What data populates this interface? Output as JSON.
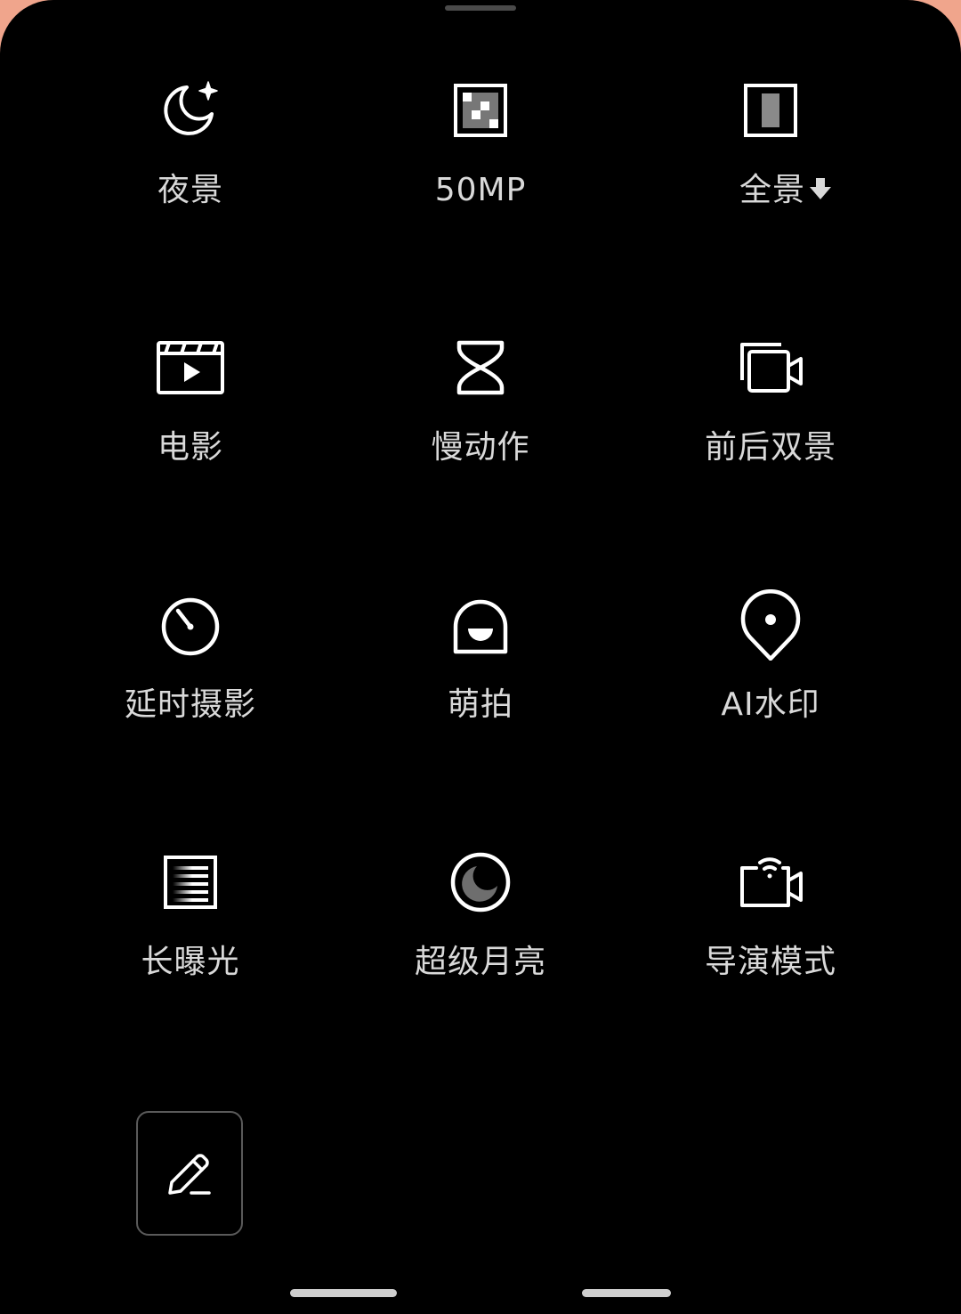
{
  "colors": {
    "background": "#000000",
    "label": "#d9d9d9",
    "icon": "#ffffff",
    "edge_accent": "#f0a58c"
  },
  "modes": [
    {
      "label": "夜景",
      "icon": "night-moon-icon"
    },
    {
      "label": "50MP",
      "icon": "50mp-grid-icon"
    },
    {
      "label": "全景",
      "icon": "panorama-icon",
      "badge": "download-arrow-icon"
    },
    {
      "label": "电影",
      "icon": "movie-clapper-icon"
    },
    {
      "label": "慢动作",
      "icon": "hourglass-icon"
    },
    {
      "label": "前后双景",
      "icon": "dual-video-icon"
    },
    {
      "label": "延时摄影",
      "icon": "timelapse-dial-icon"
    },
    {
      "label": "萌拍",
      "icon": "cute-face-icon"
    },
    {
      "label": "AI水印",
      "icon": "location-pin-icon"
    },
    {
      "label": "长曝光",
      "icon": "long-exposure-icon"
    },
    {
      "label": "超级月亮",
      "icon": "super-moon-icon"
    },
    {
      "label": "导演模式",
      "icon": "director-camera-icon"
    }
  ],
  "edit_button": {
    "icon": "pencil-icon"
  }
}
